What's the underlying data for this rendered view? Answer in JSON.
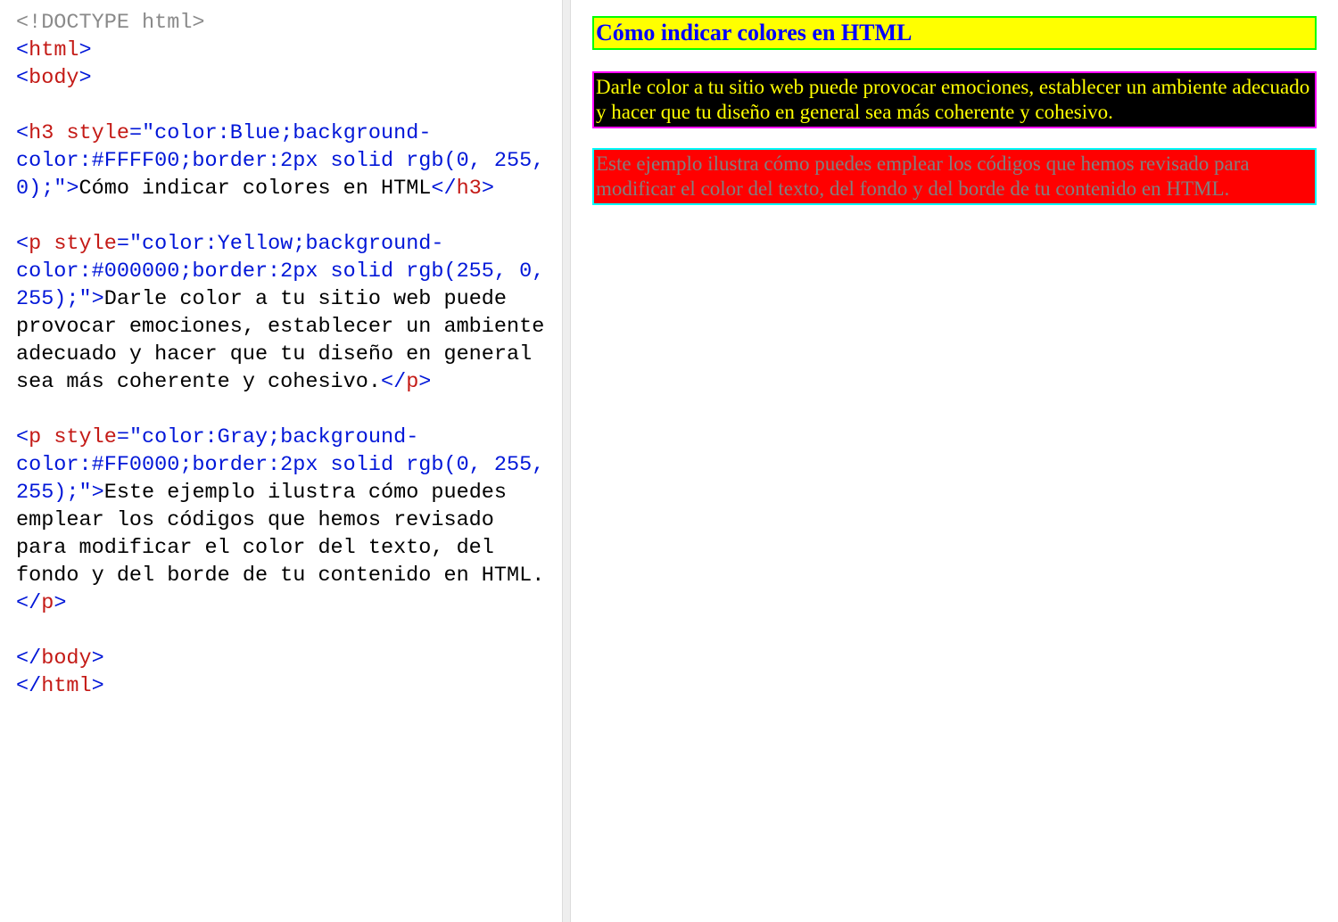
{
  "code": {
    "doctype": "<!DOCTYPE html>",
    "html_open": "html",
    "body_open": "body",
    "h3": {
      "tag": "h3",
      "style_attr": "style",
      "style_val": "\"color:Blue;background-color:#FFFF00;border:2px solid rgb(0, 255, 0);\"",
      "text": "Cómo indicar colores en HTML"
    },
    "p1": {
      "tag": "p",
      "style_attr": "style",
      "style_val": "\"color:Yellow;background-color:#000000;border:2px solid rgb(255, 0, 255);\"",
      "text": "Darle color a tu sitio web puede provocar emociones, establecer un ambiente adecuado y hacer que tu diseño en general sea más coherente y cohesivo."
    },
    "p2": {
      "tag": "p",
      "style_attr": "style",
      "style_val": "\"color:Gray;background-color:#FF0000;border:2px solid rgb(0, 255, 255);\"",
      "text": "Este ejemplo ilustra cómo puedes emplear los códigos que hemos revisado para modificar el color del texto, del fondo y del borde de tu contenido en HTML."
    },
    "body_close": "body",
    "html_close": "html"
  },
  "preview": {
    "h3": {
      "text": "Cómo indicar colores en HTML",
      "color": "blue",
      "bg": "#FFFF00",
      "border": "2px solid rgb(0,255,0)"
    },
    "p1": {
      "text": "Darle color a tu sitio web puede provocar emociones, establecer un ambiente adecuado y hacer que tu diseño en general sea más coherente y cohesivo.",
      "color": "yellow",
      "bg": "#000000",
      "border": "2px solid rgb(255,0,255)"
    },
    "p2": {
      "text": "Este ejemplo ilustra cómo puedes emplear los códigos que hemos revisado para modificar el color del texto, del fondo y del borde de tu contenido en HTML.",
      "color": "gray",
      "bg": "#FF0000",
      "border": "2px solid rgb(0,255,255)"
    }
  }
}
